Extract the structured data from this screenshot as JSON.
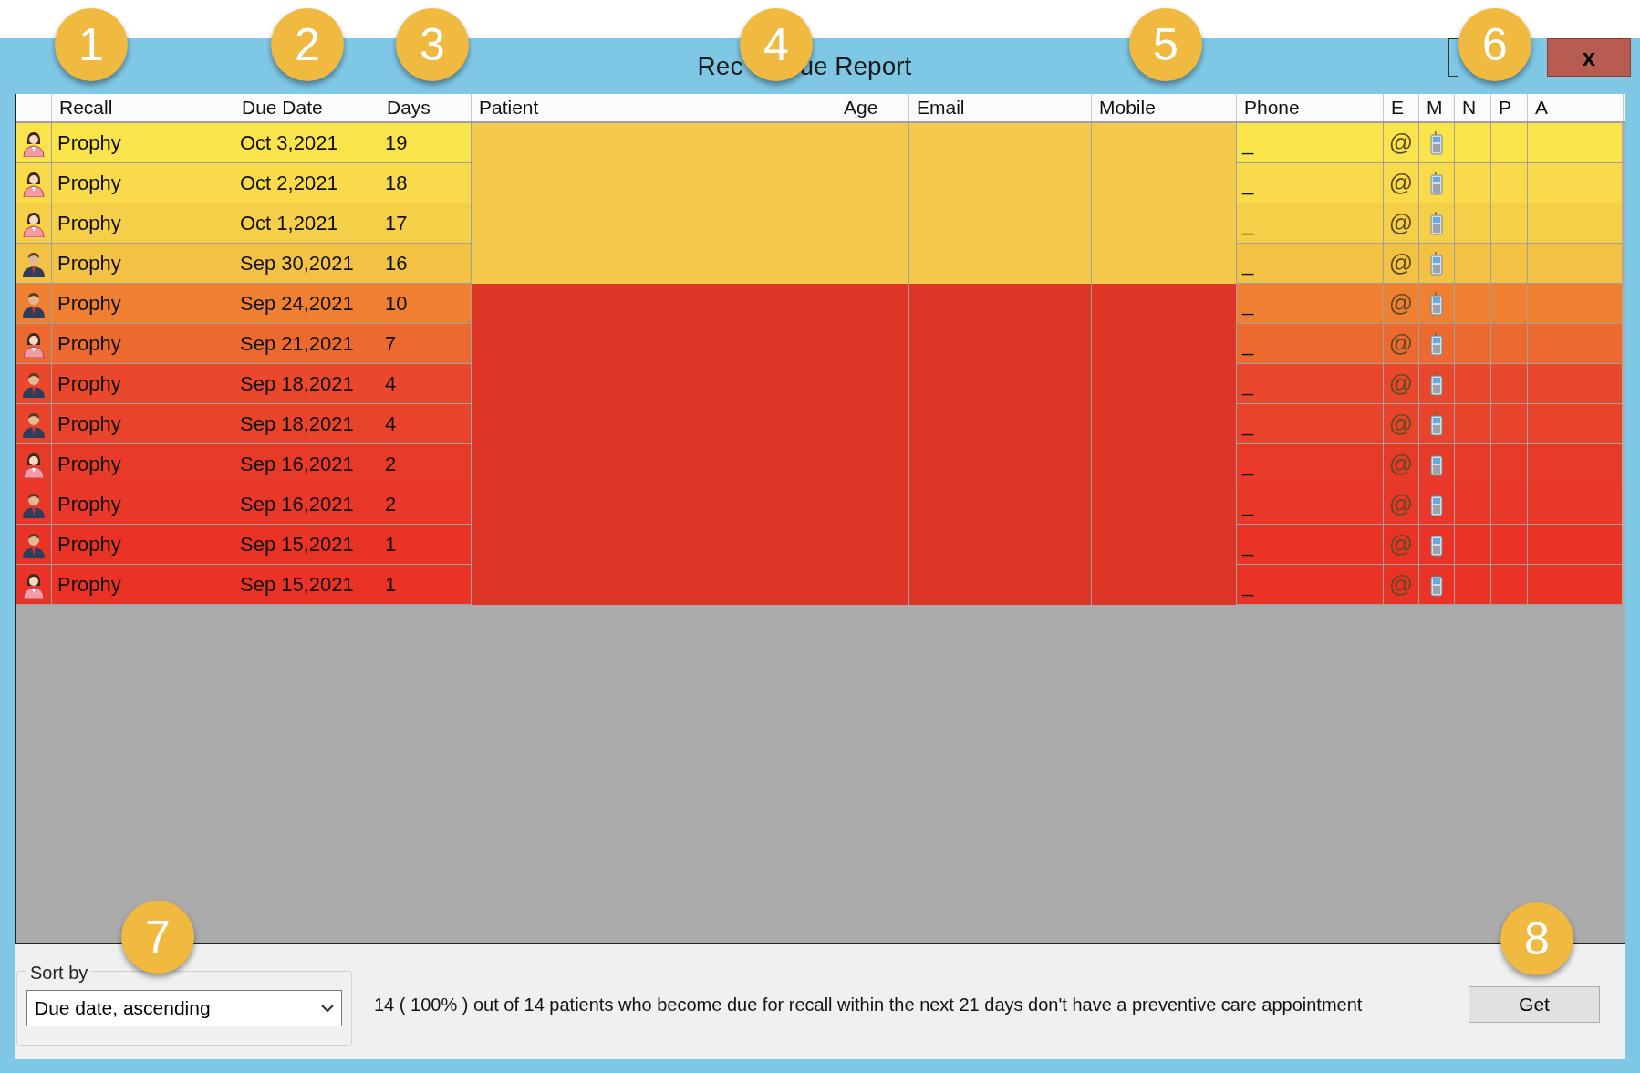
{
  "window": {
    "title_parts": [
      "Rec",
      "ue Report"
    ],
    "close_label": "x"
  },
  "table": {
    "columns": [
      "Recall",
      "Due Date",
      "Days",
      "Patient",
      "Age",
      "Email",
      "Mobile",
      "Phone",
      "E",
      "M",
      "N",
      "P",
      "A"
    ],
    "row_groups": [
      {
        "mask": {
          "color": "#f2c94a"
        },
        "rows": [
          {
            "kind": "female",
            "recall": "Prophy",
            "due_date": "Oct 3,2021",
            "days": "19",
            "phone": "_",
            "email_mark": "@",
            "color": "#f9e44c"
          },
          {
            "kind": "female",
            "recall": "Prophy",
            "due_date": "Oct 2,2021",
            "days": "18",
            "phone": "_",
            "email_mark": "@",
            "color": "#f8da4a"
          },
          {
            "kind": "female",
            "recall": "Prophy",
            "due_date": "Oct 1,2021",
            "days": "17",
            "phone": "_",
            "email_mark": "@",
            "color": "#f6cf48"
          },
          {
            "kind": "male",
            "recall": "Prophy",
            "due_date": "Sep 30,2021",
            "days": "16",
            "phone": "_",
            "email_mark": "@",
            "color": "#f3c244"
          }
        ]
      },
      {
        "mask": {
          "color": "#de3626"
        },
        "rows": [
          {
            "kind": "male",
            "recall": "Prophy",
            "due_date": "Sep 24,2021",
            "days": "10",
            "phone": "_",
            "email_mark": "@",
            "color": "#ef8032"
          },
          {
            "kind": "female",
            "recall": "Prophy",
            "due_date": "Sep 21,2021",
            "days": "7",
            "phone": "_",
            "email_mark": "@",
            "color": "#ec6a30"
          },
          {
            "kind": "male",
            "recall": "Prophy",
            "due_date": "Sep 18,2021",
            "days": "4",
            "phone": "_",
            "email_mark": "@",
            "color": "#e9482d"
          },
          {
            "kind": "male",
            "recall": "Prophy",
            "due_date": "Sep 18,2021",
            "days": "4",
            "phone": "_",
            "email_mark": "@",
            "color": "#e8442b"
          },
          {
            "kind": "female",
            "recall": "Prophy",
            "due_date": "Sep 16,2021",
            "days": "2",
            "phone": "_",
            "email_mark": "@",
            "color": "#e83a29"
          },
          {
            "kind": "male",
            "recall": "Prophy",
            "due_date": "Sep 16,2021",
            "days": "2",
            "phone": "_",
            "email_mark": "@",
            "color": "#e93729"
          },
          {
            "kind": "male",
            "recall": "Prophy",
            "due_date": "Sep 15,2021",
            "days": "1",
            "phone": "_",
            "email_mark": "@",
            "color": "#ea3327"
          },
          {
            "kind": "female",
            "recall": "Prophy",
            "due_date": "Sep 15,2021",
            "days": "1",
            "phone": "_",
            "email_mark": "@",
            "color": "#ea3227"
          }
        ]
      }
    ]
  },
  "footer": {
    "sort_legend": "Sort by",
    "sort_value": "Due date, ascending",
    "summary": "14 ( 100% ) out of 14 patients who become due for recall within the next 21 days don't have a preventive care appointment",
    "get_button": "Get"
  },
  "callouts": [
    "1",
    "2",
    "3",
    "4",
    "5",
    "6",
    "7",
    "8"
  ]
}
